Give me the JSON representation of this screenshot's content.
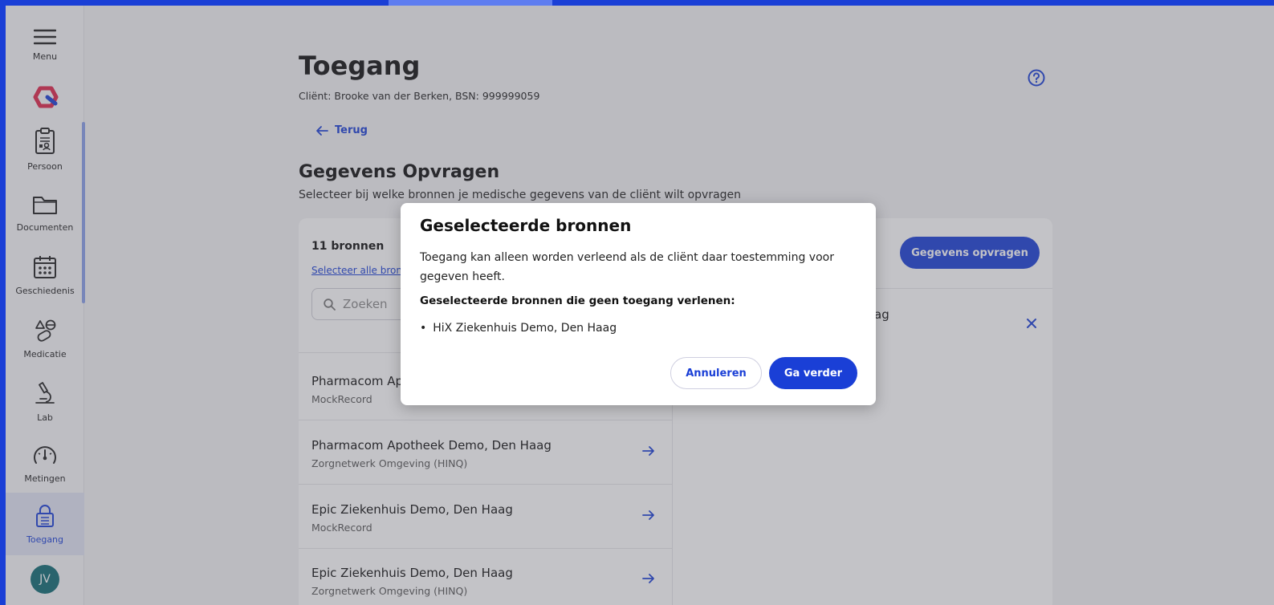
{
  "sidebar": {
    "menu_label": "Menu",
    "items": [
      {
        "label": "Persoon",
        "icon": "clipboard-person-icon"
      },
      {
        "label": "Documenten",
        "icon": "folder-icon"
      },
      {
        "label": "Geschiedenis",
        "icon": "calendar-icon"
      },
      {
        "label": "Medicatie",
        "icon": "pills-icon"
      },
      {
        "label": "Lab",
        "icon": "microscope-icon"
      },
      {
        "label": "Metingen",
        "icon": "gauge-icon"
      },
      {
        "label": "Toegang",
        "icon": "lock-icon"
      }
    ],
    "avatar_initials": "JV"
  },
  "header": {
    "title": "Toegang",
    "client_line": "Cliënt: Brooke van der Berken, BSN: 999999059",
    "back_label": "Terug"
  },
  "section": {
    "title": "Gegevens Opvragen",
    "subtitle": "Selecteer bij welke bronnen je medische gegevens van de cliënt wilt opvragen"
  },
  "card": {
    "count": "11 bronnen",
    "select_all": "Selecteer alle bronnen",
    "search_placeholder": "Zoeken",
    "request_button": "Gegevens opvragen",
    "right_item_tail": "ag",
    "list": [
      {
        "name": "Pharmacom Apotheek Demo, Den Haag",
        "sub": "MockRecord"
      },
      {
        "name": "Pharmacom Apotheek Demo, Den Haag",
        "sub": "Zorgnetwerk Omgeving (HINQ)"
      },
      {
        "name": "Epic Ziekenhuis Demo, Den Haag",
        "sub": "MockRecord"
      },
      {
        "name": "Epic Ziekenhuis Demo, Den Haag",
        "sub": "Zorgnetwerk Omgeving (HINQ)"
      }
    ]
  },
  "modal": {
    "title": "Geselecteerde bronnen",
    "text": "Toegang kan alleen worden verleend als de cliënt daar toestemming voor gegeven heeft.",
    "subheading": "Geselecteerde bronnen die geen toegang verlenen:",
    "items": [
      "HiX Ziekenhuis Demo, Den Haag"
    ],
    "cancel_label": "Annuleren",
    "continue_label": "Ga verder"
  },
  "colors": {
    "accent": "#1a3fd6",
    "avatar": "#0f6b73",
    "logo_red": "#e0264a"
  }
}
